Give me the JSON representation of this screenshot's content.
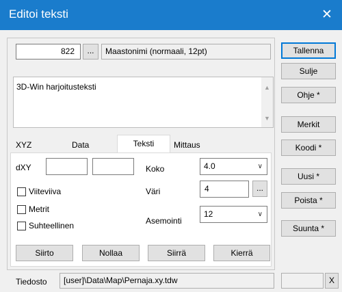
{
  "window": {
    "title": "Editoi teksti",
    "close_glyph": "✕"
  },
  "top": {
    "number_value": "822",
    "dots_label": "...",
    "label_text": "Maastonimi (normaali, 12pt)"
  },
  "text_area": {
    "value": "3D-Win harjoitusteksti",
    "scroll_up": "▲",
    "scroll_down": "▼"
  },
  "tabs": [
    {
      "label": "XYZ",
      "active": false
    },
    {
      "label": "Data",
      "active": false
    },
    {
      "label": "Teksti",
      "active": true
    },
    {
      "label": "Mittaus",
      "active": false
    }
  ],
  "teksti": {
    "dxy_label": "dXY",
    "dxy_value1": "",
    "dxy_value2": "",
    "koko_label": "Koko",
    "koko_value": "4.0",
    "vari_label": "Väri",
    "vari_value": "4",
    "vari_dots": "...",
    "asemointi_label": "Asemointi",
    "asemointi_value": "12",
    "checkboxes": [
      {
        "label": "Viiteviiva",
        "checked": false
      },
      {
        "label": "Metrit",
        "checked": false
      },
      {
        "label": "Suhteellinen",
        "checked": false
      }
    ],
    "buttons": [
      "Siirto",
      "Nollaa",
      "Siirrä",
      "Kierrä"
    ]
  },
  "side_buttons": [
    "Tallenna",
    "Sulje",
    "Ohje *",
    "Merkit",
    "Koodi *",
    "Uusi *",
    "Poista *",
    "Suunta *"
  ],
  "footer": {
    "label": "Tiedosto",
    "path": "[user]\\Data\\Map\\Pernaja.xy.tdw",
    "extra": "",
    "x_label": "X"
  },
  "colors": {
    "titlebar": "#1a7ccc",
    "default_border": "#0078d7"
  }
}
